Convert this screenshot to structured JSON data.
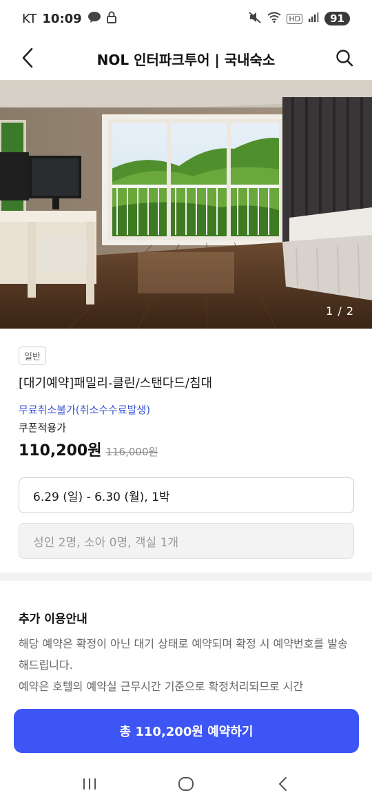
{
  "status_bar": {
    "carrier": "KT",
    "time": "10:09",
    "network": "HD",
    "battery": "91"
  },
  "header": {
    "title": "NOL 인터파크투어 | 국내숙소"
  },
  "gallery": {
    "counter": "1 / 2"
  },
  "room": {
    "tag": "일반",
    "name": "[대기예약]패밀리-클린/스탠다드/침대",
    "cancel_policy": "무료취소불가(취소수수료발생)",
    "coupon_label": "쿠폰적용가",
    "price": "110,200원",
    "original_price": "116,000원"
  },
  "booking": {
    "dates": "6.29 (일) - 6.30 (월), 1박",
    "guests": "성인 2명, 소아 0명, 객실 1개"
  },
  "extra_info": {
    "title": "추가 이용안내",
    "body": "해당 예약은 확정이 아닌 대기 상태로 예약되며 확정 시 예약번호를 발송해드립니다.\n예약은 호텔의 예약실 근무시간 기준으로 확정처리되므로 시간"
  },
  "cta": {
    "label": "총 110,200원 예약하기"
  },
  "colors": {
    "accent": "#3d55f5",
    "link": "#3d57d6"
  }
}
